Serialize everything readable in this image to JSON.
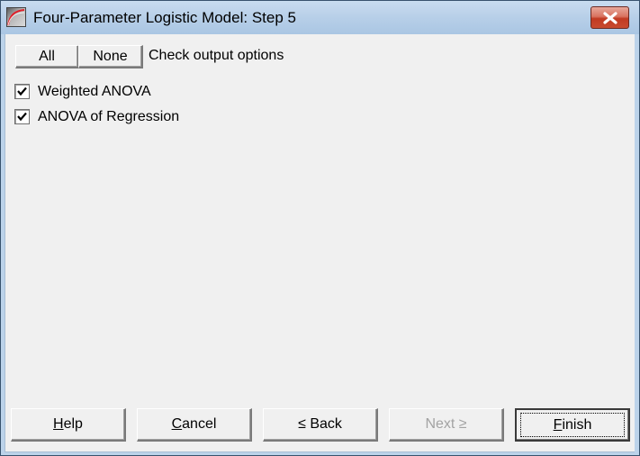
{
  "window": {
    "title": "Four-Parameter Logistic Model: Step 5",
    "app_icon": "logistic-curve-app-icon",
    "close_icon": "close-x-icon"
  },
  "selection": {
    "all_label": "All",
    "none_label": "None",
    "hint": "Check output options"
  },
  "options": [
    {
      "label": "Weighted ANOVA",
      "checked": true
    },
    {
      "label": "ANOVA of Regression",
      "checked": true
    }
  ],
  "footer": {
    "help": {
      "mnemonic": "H",
      "rest": "elp"
    },
    "cancel": {
      "mnemonic": "C",
      "rest": "ancel"
    },
    "back": {
      "mnemonic": "<",
      "rest": " Back",
      "display_mnemonic": "≤"
    },
    "next": {
      "prefix": "Next ",
      "mnemonic": "≥",
      "enabled": false
    },
    "finish": {
      "mnemonic": "F",
      "rest": "inish",
      "default": true
    }
  },
  "colors": {
    "titlebar": "#b7cfe8",
    "close_button": "#c13a22",
    "dialog_bg": "#f0f0f0",
    "disabled_text": "#a3a3a3"
  }
}
